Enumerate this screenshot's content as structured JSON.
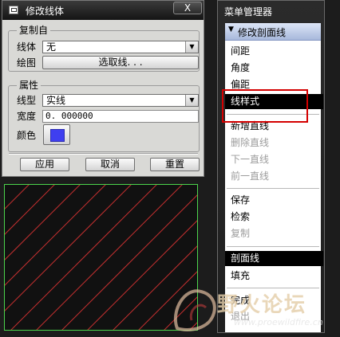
{
  "dialog": {
    "title": "修改线体",
    "close_label": "X",
    "copy_from": {
      "legend": "复制自",
      "line_body_label": "线体",
      "line_body_value": "无",
      "plot_label": "绘图",
      "select_line_button": "选取线. . ."
    },
    "attributes": {
      "legend": "属性",
      "line_type_label": "线型",
      "line_type_value": "实线",
      "width_label": "宽度",
      "width_value": "0. 000000",
      "color_label": "颜色",
      "color_value": "#3f3ff0"
    },
    "buttons": {
      "apply": "应用",
      "cancel": "取消",
      "reset": "重置"
    }
  },
  "preview": {
    "border_color": "#4cd44c",
    "hatch_color": "#c43030",
    "background": "#111111"
  },
  "menu_manager": {
    "title": "菜单管理器",
    "header": "修改剖面线",
    "items": [
      {
        "label": "间距",
        "state": "enabled"
      },
      {
        "label": "角度",
        "state": "enabled"
      },
      {
        "label": "偏距",
        "state": "enabled"
      },
      {
        "label": "线样式",
        "state": "selected"
      },
      {
        "label": "新增直线",
        "state": "enabled"
      },
      {
        "label": "删除直线",
        "state": "disabled"
      },
      {
        "label": "下一直线",
        "state": "disabled"
      },
      {
        "label": "前一直线",
        "state": "disabled"
      },
      {
        "label": "保存",
        "state": "enabled"
      },
      {
        "label": "检索",
        "state": "enabled"
      },
      {
        "label": "复制",
        "state": "disabled"
      },
      {
        "label": "剖面线",
        "state": "selected"
      },
      {
        "label": "填充",
        "state": "enabled"
      },
      {
        "label": "完成",
        "state": "enabled"
      },
      {
        "label": "退出",
        "state": "disabled"
      }
    ]
  },
  "annotation": {
    "highlight_color": "#d40000"
  },
  "watermark": {
    "text": "野火论坛",
    "url": "www.proewildfire.cn"
  }
}
